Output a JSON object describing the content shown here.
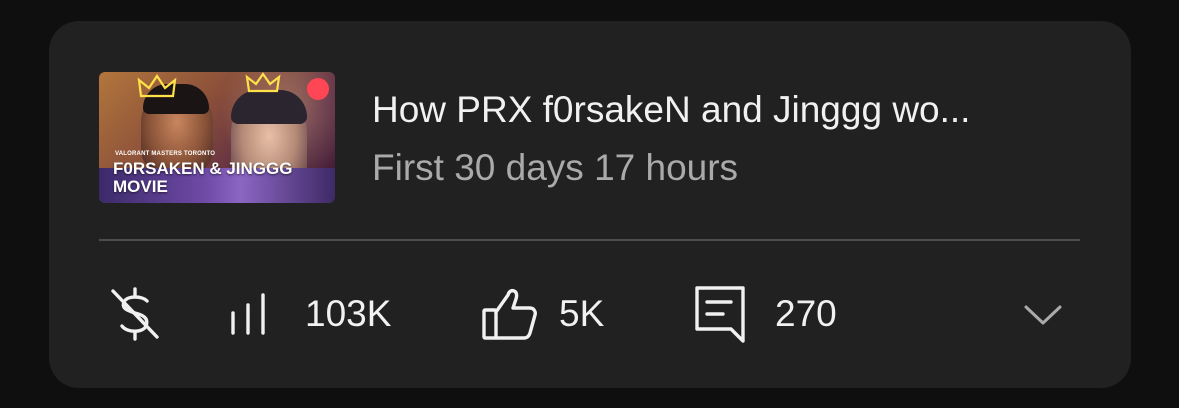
{
  "video": {
    "thumbnail": {
      "small_text": "VALORANT MASTERS TORONTO",
      "line1": "F0RSAKEN & JINGGG",
      "line2": "MOVIE"
    },
    "title": "How PRX f0rsakeN and Jinggg wo...",
    "subtitle": "First 30 days 17 hours"
  },
  "stats": {
    "monetization_icon": "dollar-slash-icon",
    "views_icon": "bar-chart-icon",
    "views": "103K",
    "likes_icon": "thumbs-up-icon",
    "likes": "5K",
    "comments_icon": "comment-icon",
    "comments": "270",
    "expand_icon": "chevron-down-icon"
  },
  "colors": {
    "background": "#0f0f0f",
    "card": "#212121",
    "text_primary": "#f1f1f1",
    "text_secondary": "#aaaaaa",
    "divider": "#4d4d4d"
  }
}
